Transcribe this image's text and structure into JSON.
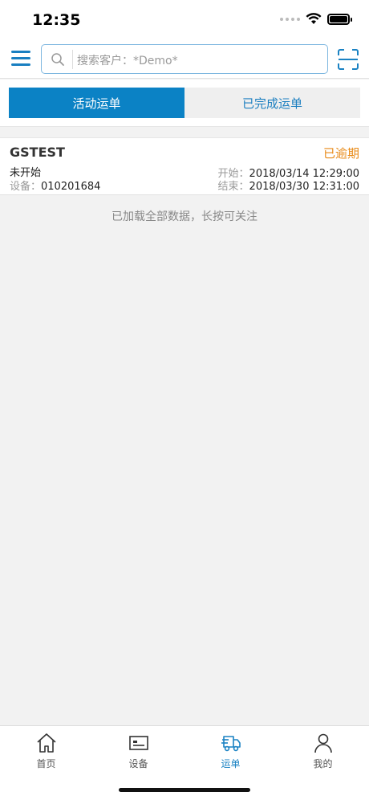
{
  "status_bar": {
    "time": "12:35"
  },
  "header": {
    "search_placeholder": "搜索客户：*Demo*",
    "menu_icon": "menu-icon",
    "scan_icon": "scan-icon"
  },
  "tabs": [
    {
      "label": "活动运单",
      "active": true
    },
    {
      "label": "已完成运单",
      "active": false
    }
  ],
  "orders": [
    {
      "name": "GSTEST",
      "state": "已逾期",
      "state_color": "#e88a17",
      "status": "未开始",
      "device_label": "设备：",
      "device": "010201684",
      "start_label": "开始：",
      "start": "2018/03/14 12:29:00",
      "end_label": "结束：",
      "end": "2018/03/30 12:31:00"
    }
  ],
  "load_note": "已加载全部数据，长按可关注",
  "tabbar": [
    {
      "label": "首页",
      "icon": "home-icon",
      "active": false
    },
    {
      "label": "设备",
      "icon": "device-icon",
      "active": false
    },
    {
      "label": "运单",
      "icon": "truck-icon",
      "active": true
    },
    {
      "label": "我的",
      "icon": "user-icon",
      "active": false
    }
  ],
  "colors": {
    "accent": "#0b82c5",
    "overdue": "#e88a17"
  }
}
